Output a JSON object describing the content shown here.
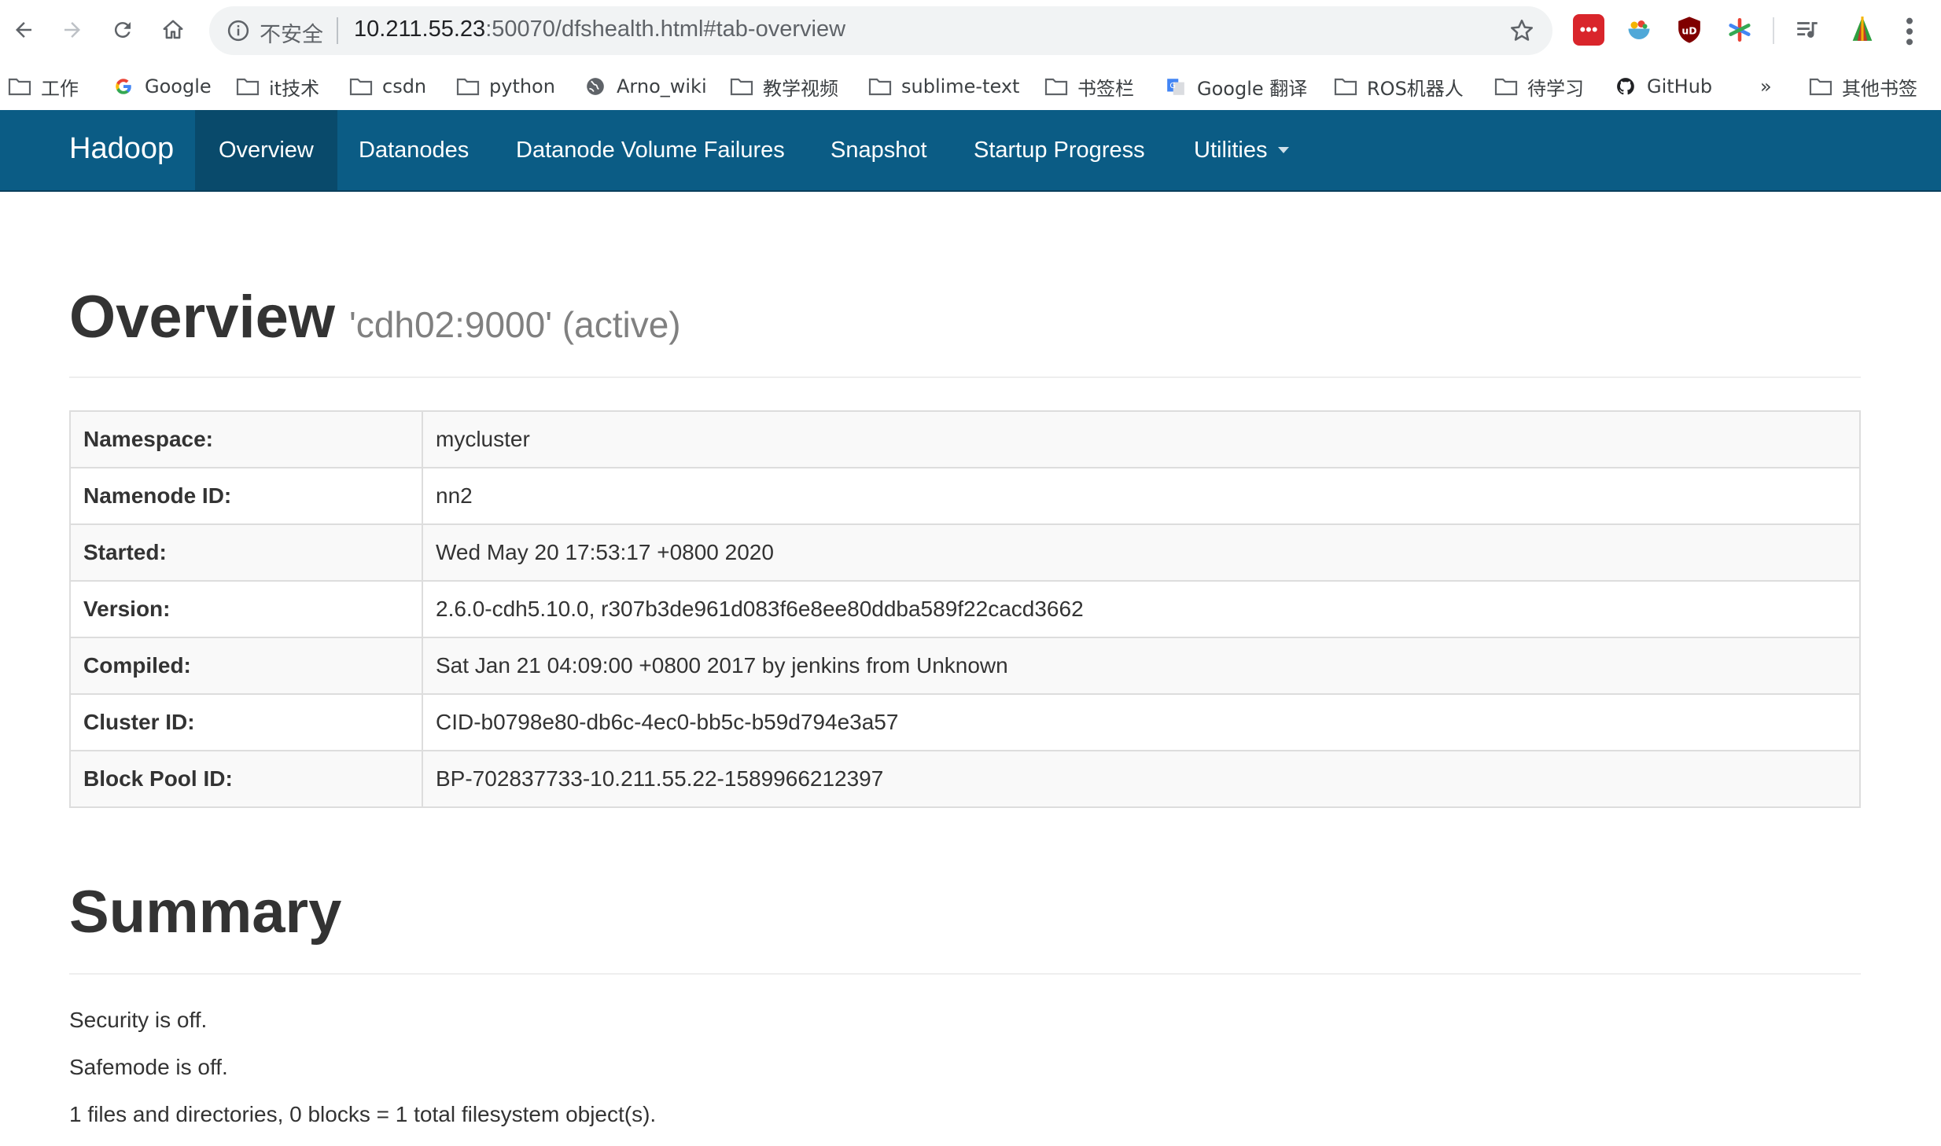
{
  "browser": {
    "url_host": "10.211.55.23",
    "url_rest": ":50070/dfshealth.html#tab-overview",
    "security_label": "不安全"
  },
  "bookmarks": [
    {
      "label": "工作",
      "icon": "folder-icon"
    },
    {
      "label": "Google",
      "icon": "google-icon"
    },
    {
      "label": "it技术",
      "icon": "folder-icon"
    },
    {
      "label": "csdn",
      "icon": "folder-icon"
    },
    {
      "label": "python",
      "icon": "folder-icon"
    },
    {
      "label": "Arno_wiki",
      "icon": "globe-icon"
    },
    {
      "label": "教学视频",
      "icon": "folder-icon"
    },
    {
      "label": "sublime-text",
      "icon": "folder-icon"
    },
    {
      "label": "书签栏",
      "icon": "folder-icon"
    },
    {
      "label": "Google 翻译",
      "icon": "translate-icon"
    },
    {
      "label": "ROS机器人",
      "icon": "folder-icon"
    },
    {
      "label": "待学习",
      "icon": "folder-icon"
    },
    {
      "label": "GitHub",
      "icon": "github-icon"
    },
    {
      "label": "»",
      "icon": "chevron-icon"
    },
    {
      "label": "其他书签",
      "icon": "folder-icon"
    }
  ],
  "navbar": {
    "brand": "Hadoop",
    "items": [
      {
        "label": "Overview",
        "active": true
      },
      {
        "label": "Datanodes"
      },
      {
        "label": "Datanode Volume Failures"
      },
      {
        "label": "Snapshot"
      },
      {
        "label": "Startup Progress"
      },
      {
        "label": "Utilities",
        "dropdown": true
      }
    ]
  },
  "overview": {
    "title": "Overview",
    "subtitle": "'cdh02:9000' (active)",
    "rows": [
      {
        "key": "Namespace:",
        "value": "mycluster"
      },
      {
        "key": "Namenode ID:",
        "value": "nn2"
      },
      {
        "key": "Started:",
        "value": "Wed May 20 17:53:17 +0800 2020"
      },
      {
        "key": "Version:",
        "value": "2.6.0-cdh5.10.0, r307b3de961d083f6e8ee80ddba589f22cacd3662"
      },
      {
        "key": "Compiled:",
        "value": "Sat Jan 21 04:09:00 +0800 2017 by jenkins from Unknown"
      },
      {
        "key": "Cluster ID:",
        "value": "CID-b0798e80-db6c-4ec0-bb5c-b59d794e3a57"
      },
      {
        "key": "Block Pool ID:",
        "value": "BP-702837733-10.211.55.22-1589966212397"
      }
    ]
  },
  "summary": {
    "title": "Summary",
    "lines": [
      "Security is off.",
      "Safemode is off.",
      "1 files and directories, 0 blocks = 1 total filesystem object(s)."
    ]
  },
  "colors": {
    "navbar_bg": "#0b5c85",
    "navbar_active": "#094a6b",
    "text": "#333333",
    "subtitle": "#808080"
  }
}
